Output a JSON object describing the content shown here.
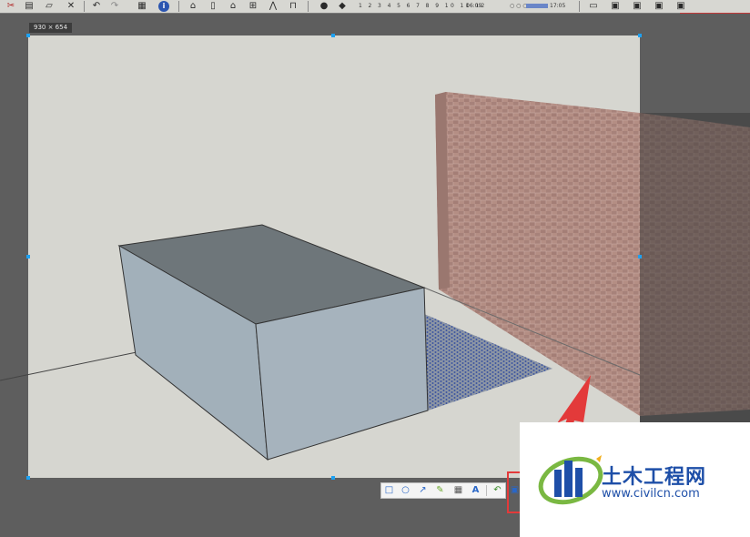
{
  "toolbar": {
    "icons": [
      "scissors-icon",
      "paste-icon",
      "erase-icon",
      "delete-icon",
      "undo-icon",
      "redo-icon",
      "print-icon",
      "info-icon",
      "house-icon",
      "door-icon",
      "home-icon",
      "window-icon",
      "roof-icon",
      "stairs-icon",
      "shadow-settings-icon",
      "fog-icon"
    ],
    "month_ticks": "1 2 3 4 5 6 7 8 9 10 11 12",
    "time_start": "06:09",
    "time_end": "17:05",
    "time_control": "○ ○ ○",
    "right_icons": [
      "layer-icon",
      "scene-icon",
      "component-icon",
      "material-icon",
      "style-icon"
    ]
  },
  "selection": {
    "size_label": "930 × 654"
  },
  "annotation_toolbar": {
    "tools": [
      "rectangle-tool-icon",
      "ellipse-tool-icon",
      "arrow-tool-icon",
      "pen-tool-icon",
      "mosaic-tool-icon",
      "text-tool-icon",
      "undo-tool-icon",
      "save-tool-icon"
    ]
  },
  "watermark": {
    "title": "土木工程网",
    "url": "www.civilcn.com"
  },
  "colors": {
    "background_gray": "#5e5e5e",
    "ground": "#d6d6d0",
    "box_top": "#6e767a",
    "box_side": "#a2b0ba",
    "brick": "#b08c82",
    "shadow_hatch": "#3f568e",
    "selection_handle": "#1da1f2",
    "annotation_red": "#e33a3a",
    "brand_blue": "#1e4fa8"
  }
}
